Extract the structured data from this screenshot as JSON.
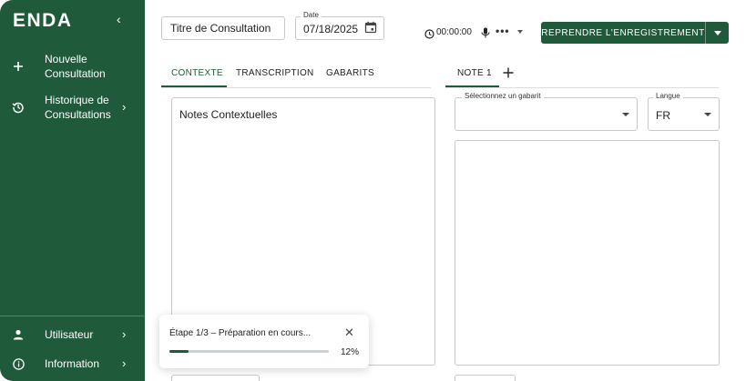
{
  "sidebar": {
    "logo": "ENDA",
    "items": [
      {
        "label": "Nouvelle Consultation",
        "icon": "plus-icon"
      },
      {
        "label": "Historique de Consultations",
        "icon": "history-icon"
      },
      {
        "label": "Utilisateur",
        "icon": "user-icon"
      },
      {
        "label": "Information",
        "icon": "info-icon"
      }
    ]
  },
  "header": {
    "title_value": "Titre de Consultation",
    "date_label": "Date",
    "date_value": "07/18/2025",
    "timer": "00:00:00",
    "record_button": "REPRENDRE L'ENREGISTREMENT"
  },
  "tabs": {
    "left": [
      "CONTEXTE",
      "TRANSCRIPTION",
      "GABARITS"
    ],
    "active_left": "CONTEXTE",
    "right": [
      "NOTE 1"
    ],
    "active_right": "NOTE 1"
  },
  "context": {
    "text": "Notes Contextuelles"
  },
  "note": {
    "template_label": "Sélectionnez un gabarit",
    "template_value": "",
    "language_label": "Langue",
    "language_value": "FR"
  },
  "toast": {
    "message": "Étape 1/3 – Préparation en cours...",
    "progress": 0.12,
    "progress_label": "12%"
  },
  "colors": {
    "brand": "#1f5a3a",
    "track": "#c6d4cb"
  }
}
